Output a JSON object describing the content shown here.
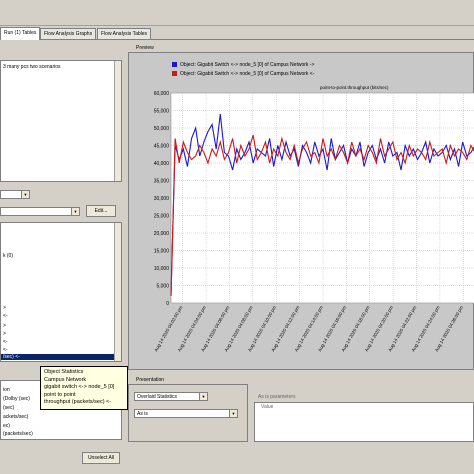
{
  "tabs": [
    "Run (1) Tables",
    "Flow Analysis Graphs",
    "Flow Analysis Tables"
  ],
  "preview_label": "Preview",
  "scenario_text": "3 many pcs two scenarios",
  "edit_button": "Edit...",
  "tree_items": [
    "k (0)",
    ">",
    "<-",
    ">",
    ">",
    "<-",
    "<-",
    "/sec) <-"
  ],
  "bottom_list": [
    "ion",
    "(Dolby (sec)",
    "(sec)",
    "ackets/sec)",
    "ec)",
    "(packets/sec)"
  ],
  "unselect_button": "Unselect All",
  "tooltip_lines": [
    "Object Statistics",
    "Campus Network",
    "gigabit switch <-> node_5 [0]",
    "point to point",
    "throughput (packets/sec) <-"
  ],
  "presentation_label": "Presentation",
  "presentation_mode": "Overlaid Statistics",
  "as_is_value": "As is",
  "as_is_params_label": "As is parameters",
  "value_column": "Value",
  "chart_data": {
    "type": "line",
    "title": "point-to-point.throughput (bits/sec)",
    "ylim": [
      0,
      60000
    ],
    "yticks": [
      0,
      5000,
      10000,
      15000,
      20000,
      25000,
      30000,
      35000,
      40000,
      45000,
      50000,
      55000,
      60000
    ],
    "ytick_labels": [
      "0",
      "5,000",
      "10,000",
      "15,000",
      "20,000",
      "25,000",
      "30,000",
      "35,000",
      "40,000",
      "45,000",
      "50,000",
      "55,000",
      "60,000"
    ],
    "xtick_labels": [
      "Aug 14 2020 04:02:00 pm",
      "Aug 14 2020 04:04:00 pm",
      "Aug 14 2020 04:06:00 pm",
      "Aug 14 2020 04:08:00 pm",
      "Aug 14 2020 04:10:00 pm",
      "Aug 14 2020 04:12:00 pm",
      "Aug 14 2020 04:14:00 pm",
      "Aug 14 2020 04:16:00 pm",
      "Aug 14 2020 04:18:00 pm",
      "Aug 14 2020 04:20:00 pm",
      "Aug 14 2020 04:22:00 pm",
      "Aug 14 2020 04:24:00 pm",
      "Aug 14 2020 04:26:00 pm"
    ],
    "grid": true,
    "series": [
      {
        "name": "Object: Gigabit Switch <-> node_5 [0] of Campus Network ->",
        "color": "#1a1acc",
        "values": [
          2000,
          45000,
          41000,
          44000,
          39000,
          47000,
          50000,
          42000,
          46000,
          49000,
          51000,
          44000,
          54000,
          43000,
          42000,
          38000,
          44000,
          41000,
          43000,
          46000,
          40000,
          44000,
          43000,
          42000,
          47000,
          39000,
          45000,
          41000,
          46000,
          42000,
          44000,
          39000,
          45000,
          43000,
          40000,
          46000,
          42000,
          44000,
          38000,
          47000,
          41000,
          43000,
          45000,
          40000,
          44000,
          42000,
          46000,
          39000,
          43000,
          45000,
          41000,
          44000,
          40000,
          46000,
          42000,
          43000,
          38000,
          45000,
          42000,
          44000,
          41000,
          43000,
          46000,
          40000,
          44000,
          42000,
          43000,
          45000,
          41000,
          44000,
          39000,
          46000,
          42000,
          43000,
          45000
        ]
      },
      {
        "name": "Object: Gigabit Switch <-> node_5 [0] of Campus Network <-",
        "color": "#cc1a1a",
        "values": [
          2000,
          47000,
          40000,
          46000,
          43000,
          41000,
          42000,
          45000,
          43000,
          40000,
          44000,
          42000,
          46000,
          41000,
          43000,
          47000,
          40000,
          45000,
          42000,
          44000,
          48000,
          41000,
          43000,
          46000,
          40000,
          44000,
          42000,
          47000,
          43000,
          41000,
          45000,
          40000,
          44000,
          46000,
          42000,
          43000,
          40000,
          47000,
          42000,
          44000,
          41000,
          45000,
          43000,
          40000,
          46000,
          42000,
          44000,
          41000,
          45000,
          43000,
          40000,
          47000,
          42000,
          44000,
          46000,
          41000,
          43000,
          40000,
          45000,
          42000,
          44000,
          43000,
          41000,
          46000,
          42000,
          43000,
          44000,
          40000,
          45000,
          42000,
          44000,
          43000,
          41000,
          45000,
          43000
        ]
      }
    ]
  }
}
